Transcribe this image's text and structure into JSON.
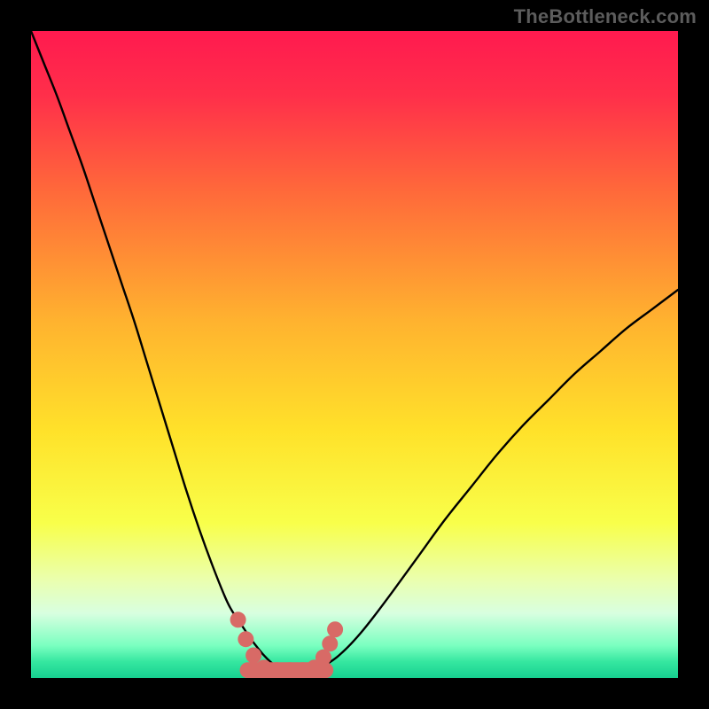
{
  "watermark": "TheBottleneck.com",
  "chart_data": {
    "type": "line",
    "title": "",
    "xlabel": "",
    "ylabel": "",
    "xlim": [
      0,
      100
    ],
    "ylim": [
      0,
      100
    ],
    "grid": false,
    "legend": null,
    "series": [
      {
        "name": "left-curve",
        "x": [
          0,
          2,
          4,
          6,
          8,
          10,
          12,
          14,
          16,
          18,
          20,
          22,
          24,
          26,
          28,
          30,
          31,
          32,
          33,
          34,
          35,
          36,
          37,
          38
        ],
        "y": [
          100,
          95,
          90,
          84.5,
          79,
          73,
          67,
          61,
          55,
          48.5,
          42,
          35.5,
          29,
          23,
          17.5,
          12.5,
          10.5,
          9,
          7.5,
          6,
          4.7,
          3.5,
          2.5,
          1.7
        ]
      },
      {
        "name": "right-curve",
        "x": [
          45,
          47,
          49,
          51,
          53,
          56,
          60,
          64,
          68,
          72,
          76,
          80,
          84,
          88,
          92,
          96,
          100
        ],
        "y": [
          1.7,
          3.0,
          4.8,
          7.0,
          9.5,
          13.5,
          19.0,
          24.5,
          29.5,
          34.5,
          39.0,
          43.0,
          47.0,
          50.5,
          54.0,
          57.0,
          60.0
        ]
      }
    ],
    "floor_band": {
      "name": "valley-floor",
      "x_start": 33.5,
      "x_end": 45.5,
      "y": 1.2
    },
    "dots": {
      "name": "valley-dots",
      "points": [
        {
          "x": 32.0,
          "y": 9.0
        },
        {
          "x": 33.2,
          "y": 6.0
        },
        {
          "x": 34.4,
          "y": 3.5
        },
        {
          "x": 36.0,
          "y": 1.6
        },
        {
          "x": 38.0,
          "y": 1.2
        },
        {
          "x": 40.0,
          "y": 1.2
        },
        {
          "x": 42.0,
          "y": 1.2
        },
        {
          "x": 43.8,
          "y": 1.6
        },
        {
          "x": 45.2,
          "y": 3.2
        },
        {
          "x": 46.2,
          "y": 5.3
        },
        {
          "x": 47.0,
          "y": 7.5
        }
      ]
    },
    "background_gradient": {
      "stops": [
        {
          "pos": 0.0,
          "color": "#ff1a4f"
        },
        {
          "pos": 0.1,
          "color": "#ff2f4a"
        },
        {
          "pos": 0.25,
          "color": "#ff6a3a"
        },
        {
          "pos": 0.45,
          "color": "#ffb32f"
        },
        {
          "pos": 0.62,
          "color": "#ffe22a"
        },
        {
          "pos": 0.76,
          "color": "#f8ff4a"
        },
        {
          "pos": 0.85,
          "color": "#eaffb0"
        },
        {
          "pos": 0.9,
          "color": "#d8ffe0"
        },
        {
          "pos": 0.95,
          "color": "#7affc0"
        },
        {
          "pos": 0.975,
          "color": "#35e7a0"
        },
        {
          "pos": 1.0,
          "color": "#17d090"
        }
      ]
    },
    "curve_color": "#000000",
    "dot_color": "#d86a66",
    "dot_radius": 9
  }
}
